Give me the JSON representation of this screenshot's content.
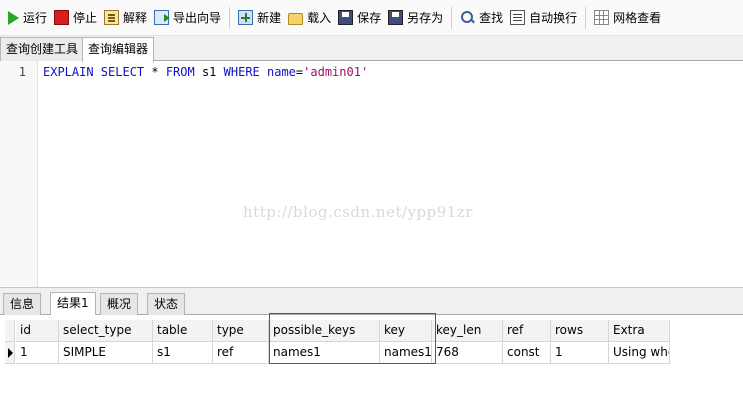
{
  "toolbar": {
    "items": [
      {
        "label": "运行",
        "icon": "run-icon"
      },
      {
        "label": "停止",
        "icon": "stop-icon"
      },
      {
        "label": "解释",
        "icon": "explain-icon"
      },
      {
        "label": "导出向导",
        "icon": "export-wizard-icon"
      },
      {
        "label": "新建",
        "icon": "new-icon"
      },
      {
        "label": "载入",
        "icon": "load-folder-icon"
      },
      {
        "label": "保存",
        "icon": "save-icon"
      },
      {
        "label": "另存为",
        "icon": "save-as-icon"
      },
      {
        "label": "查找",
        "icon": "find-icon"
      },
      {
        "label": "自动换行",
        "icon": "word-wrap-icon"
      },
      {
        "label": "网格查看",
        "icon": "grid-view-icon"
      }
    ]
  },
  "tabs": [
    {
      "label": "查询创建工具",
      "active": false
    },
    {
      "label": "查询编辑器",
      "active": true
    }
  ],
  "editor": {
    "line_number": "1",
    "code_tokens": [
      {
        "text": "EXPLAIN SELECT ",
        "kind": "kw"
      },
      {
        "text": "* ",
        "kind": "plain"
      },
      {
        "text": "FROM ",
        "kind": "kw"
      },
      {
        "text": "s1 ",
        "kind": "plain"
      },
      {
        "text": "WHERE ",
        "kind": "kw"
      },
      {
        "text": "name",
        "kind": "kw"
      },
      {
        "text": "=",
        "kind": "plain"
      },
      {
        "text": "'admin01'",
        "kind": "str"
      }
    ],
    "watermark": "http://blog.csdn.net/ypp91zr"
  },
  "bottom_tabs": [
    {
      "label": "信息",
      "active": false
    },
    {
      "label": "结果1",
      "active": true
    },
    {
      "label": "概况",
      "active": false
    },
    {
      "label": "状态",
      "active": false
    }
  ],
  "result_grid": {
    "columns": [
      "id",
      "select_type",
      "table",
      "type",
      "possible_keys",
      "key",
      "key_len",
      "ref",
      "rows",
      "Extra"
    ],
    "rows": [
      [
        "1",
        "SIMPLE",
        "s1",
        "ref",
        "names1",
        "names1",
        "768",
        "const",
        "1",
        "Using where"
      ]
    ],
    "highlight_color": "#cc2a2a"
  },
  "colors": {
    "keyword": "#1010c8",
    "string": "#a0106a",
    "run_icon": "#2aa52a",
    "stop_icon": "#d61f1f"
  }
}
